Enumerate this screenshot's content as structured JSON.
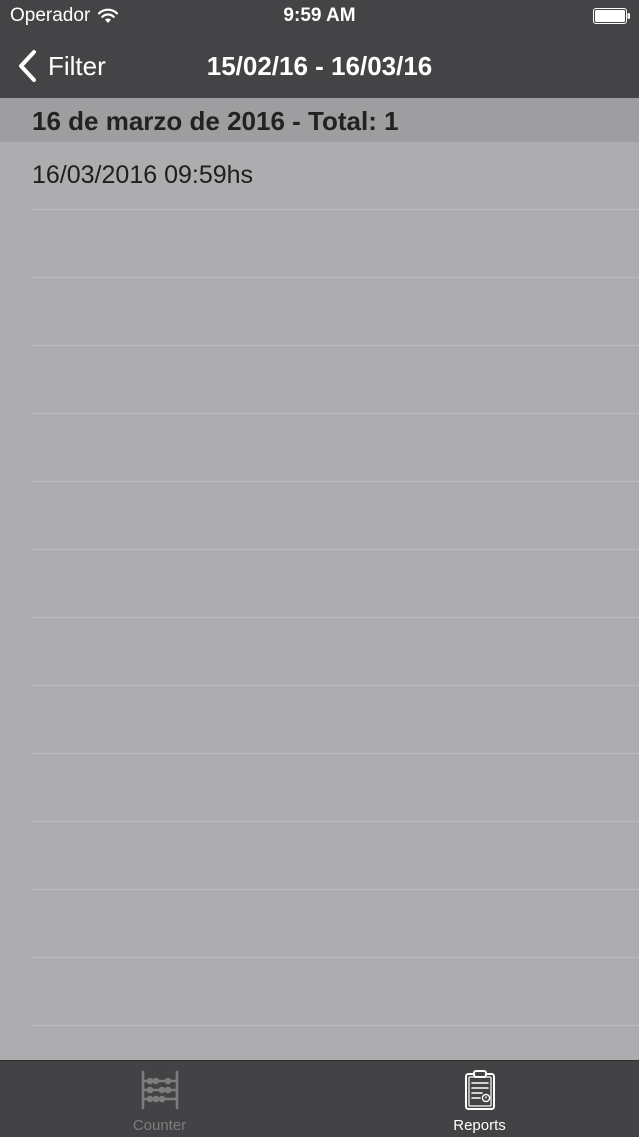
{
  "status_bar": {
    "carrier": "Operador",
    "time": "9:59 AM"
  },
  "nav": {
    "back_label": "Filter",
    "title": "15/02/16 - 16/03/16"
  },
  "section": {
    "header": "16 de marzo de 2016 - Total: 1"
  },
  "rows": [
    {
      "label": "16/03/2016 09:59hs"
    },
    {
      "label": ""
    },
    {
      "label": ""
    },
    {
      "label": ""
    },
    {
      "label": ""
    },
    {
      "label": ""
    },
    {
      "label": ""
    },
    {
      "label": ""
    },
    {
      "label": ""
    },
    {
      "label": ""
    },
    {
      "label": ""
    },
    {
      "label": ""
    },
    {
      "label": ""
    }
  ],
  "tab_bar": {
    "tabs": [
      {
        "label": "Counter",
        "icon": "abacus-icon",
        "selected": false
      },
      {
        "label": "Reports",
        "icon": "clipboard-report-icon",
        "selected": true
      }
    ]
  },
  "colors": {
    "nav_background": "#444345",
    "list_background": "#adacae",
    "section_header_background": "#9e9d9f",
    "tab_active": "#ffffff",
    "tab_inactive": "#7d7c7e"
  }
}
